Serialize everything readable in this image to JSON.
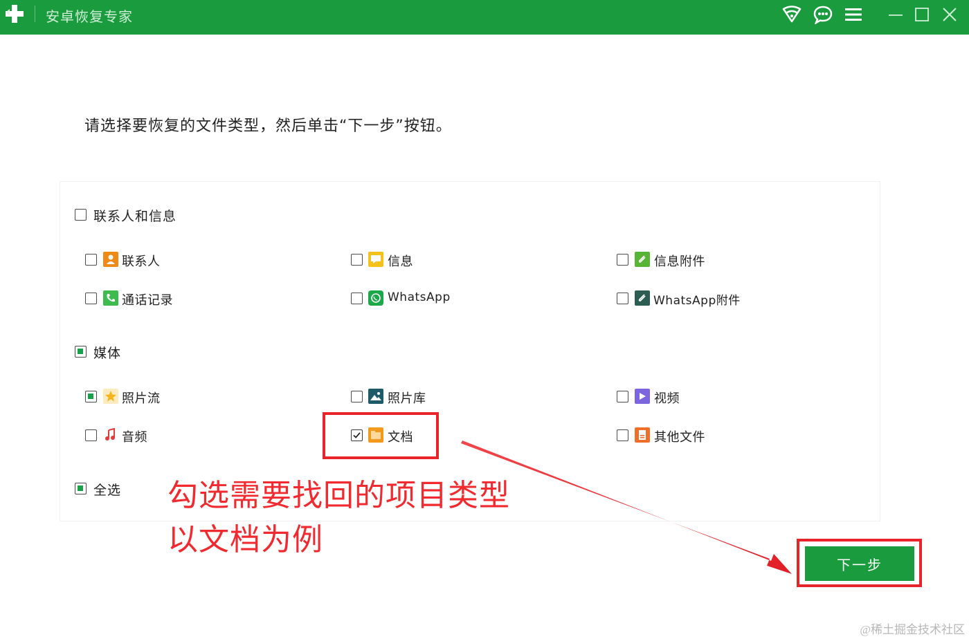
{
  "app": {
    "title": "安卓恢复专家"
  },
  "instruction": "请选择要恢复的文件类型，然后单击“下一步”按钮。",
  "groups": {
    "contacts_messages": {
      "label": "联系人和信息",
      "items": [
        {
          "label": "联系人",
          "icon": "contact-icon",
          "color": "#f08a16",
          "checked": false
        },
        {
          "label": "信息",
          "icon": "message-icon",
          "color": "#f6c21a",
          "checked": false
        },
        {
          "label": "信息附件",
          "icon": "attachment-icon",
          "color": "#58b434",
          "checked": false
        },
        {
          "label": "通话记录",
          "icon": "phone-icon",
          "color": "#3dbb4f",
          "checked": false
        },
        {
          "label": "WhatsApp",
          "icon": "whatsapp-icon",
          "color": "#1ba84a",
          "checked": false
        },
        {
          "label": "WhatsApp附件",
          "icon": "whatsapp-attachment-icon",
          "color": "#2c5d52",
          "checked": false
        }
      ]
    },
    "media": {
      "label": "媒体",
      "items": [
        {
          "label": "照片流",
          "icon": "star-photo-icon",
          "color": "#f6b51e",
          "checked": true
        },
        {
          "label": "照片库",
          "icon": "gallery-icon",
          "color": "#1e5a68",
          "checked": false
        },
        {
          "label": "视频",
          "icon": "video-icon",
          "color": "#7b66e0",
          "checked": false
        },
        {
          "label": "音频",
          "icon": "audio-icon",
          "color": "#e33b3b",
          "checked": false
        },
        {
          "label": "文档",
          "icon": "folder-icon",
          "color": "#f39a1e",
          "checked": true
        },
        {
          "label": "其他文件",
          "icon": "file-icon",
          "color": "#ee6f2a",
          "checked": false
        }
      ]
    },
    "select_all": {
      "label": "全选"
    }
  },
  "annotation": {
    "line1": "勾选需要找回的项目类型",
    "line2": "以文档为例",
    "color": "#f02a2f"
  },
  "next_button": {
    "label": "下一步"
  },
  "watermark": "@稀土掘金技术社区",
  "colors": {
    "brand": "#1a9c3e",
    "highlight": "#e8232a"
  }
}
